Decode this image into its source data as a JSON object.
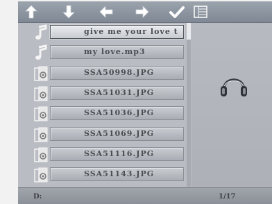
{
  "toolbar": {
    "buttons": [
      {
        "name": "up-arrow-icon"
      },
      {
        "name": "down-arrow-icon"
      },
      {
        "name": "left-arrow-icon"
      },
      {
        "name": "right-arrow-icon"
      },
      {
        "name": "checkmark-icon"
      },
      {
        "name": "list-menu-icon"
      }
    ]
  },
  "files": [
    {
      "name": "give me your love t",
      "type": "music",
      "selected": true
    },
    {
      "name": "my love.mp3",
      "type": "music",
      "selected": false
    },
    {
      "name": "SSA50998.JPG",
      "type": "image",
      "selected": false
    },
    {
      "name": "SSA51031.JPG",
      "type": "image",
      "selected": false
    },
    {
      "name": "SSA51036.JPG",
      "type": "image",
      "selected": false
    },
    {
      "name": "SSA51069.JPG",
      "type": "image",
      "selected": false
    },
    {
      "name": "SSA51116.JPG",
      "type": "image",
      "selected": false
    },
    {
      "name": "SSA51143.JPG",
      "type": "image",
      "selected": false
    }
  ],
  "preview": {
    "icon": "headphones-icon"
  },
  "status": {
    "drive": "D:",
    "page": "1/17"
  },
  "colors": {
    "background": "#b9bcc2",
    "toolbar": "#8a929c",
    "icon_white": "#ffffff"
  }
}
